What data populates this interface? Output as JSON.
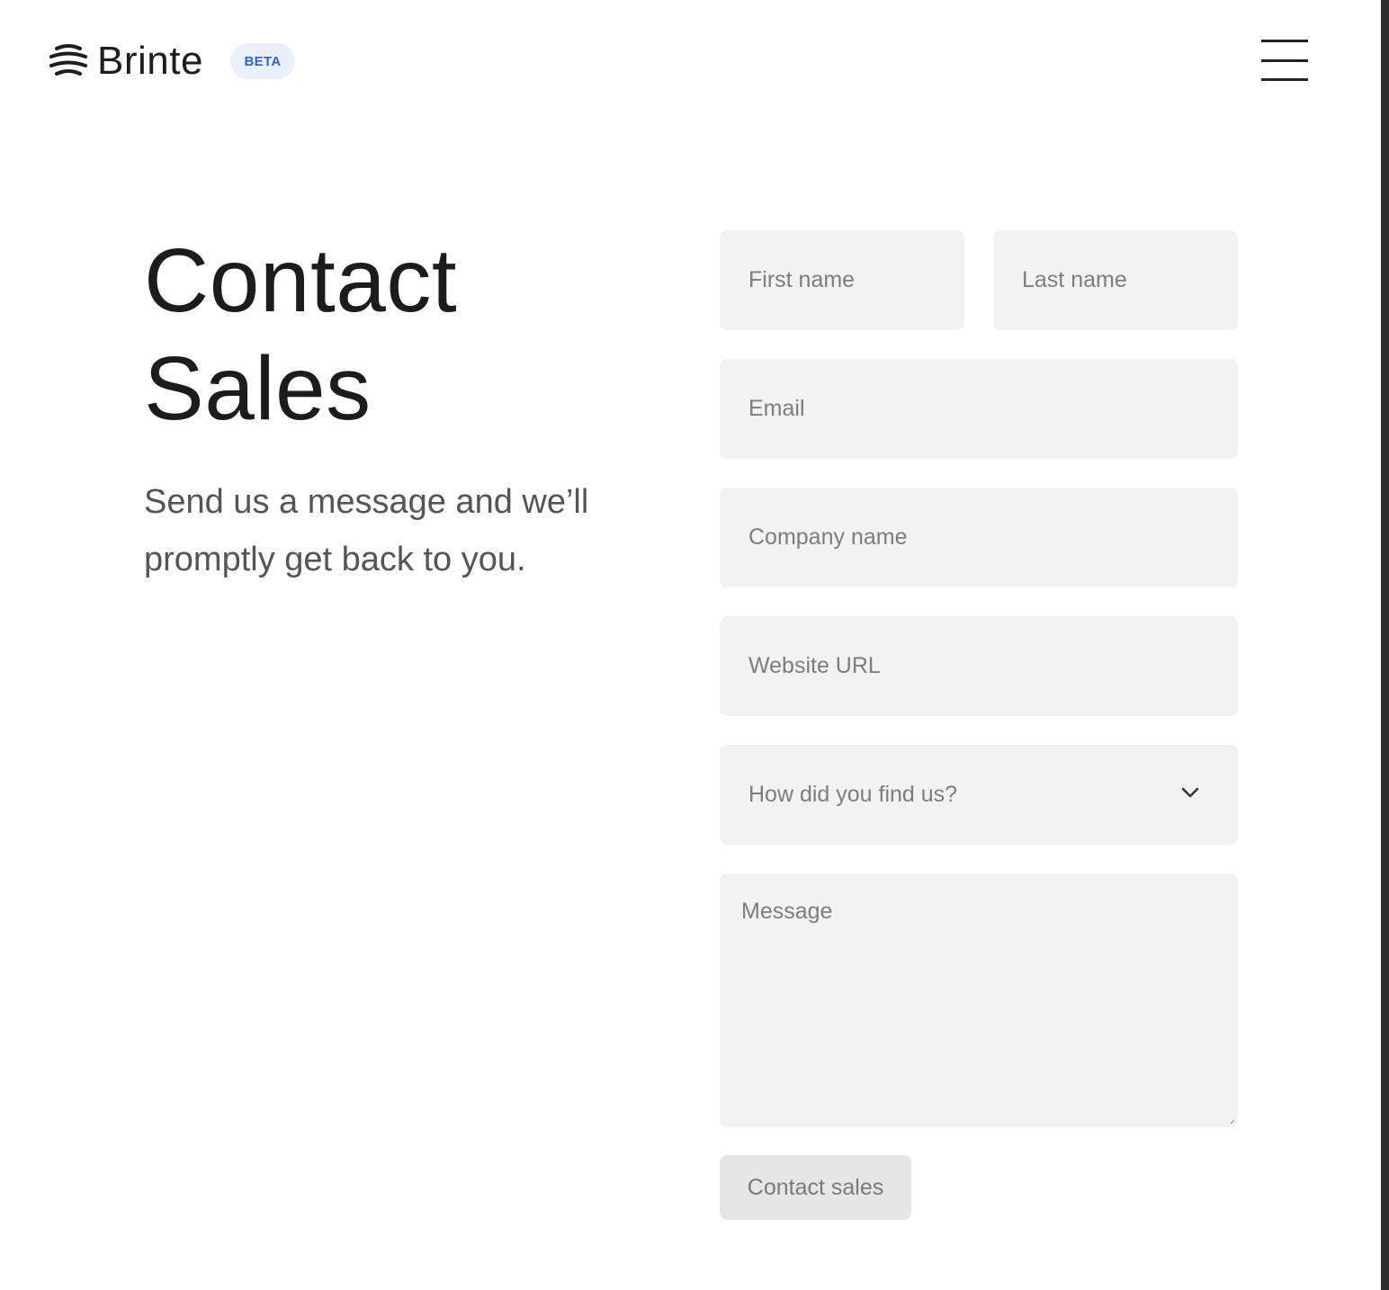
{
  "brand": {
    "name": "Brinte",
    "badge": "BETA",
    "logo_icon": "wave-lines-logo-icon",
    "badge_bg": "#e9f0fb",
    "badge_color": "#2f63c8"
  },
  "header": {
    "menu_icon": "hamburger-menu-icon"
  },
  "hero": {
    "title_line1": "Contact",
    "title_line2": "Sales",
    "subtitle": "Send us a message and we’ll promptly get back to you."
  },
  "form": {
    "first_name": {
      "placeholder": "First name",
      "value": ""
    },
    "last_name": {
      "placeholder": "Last name",
      "value": ""
    },
    "email": {
      "placeholder": "Email",
      "value": ""
    },
    "company": {
      "placeholder": "Company name",
      "value": ""
    },
    "website": {
      "placeholder": "Website URL",
      "value": ""
    },
    "source": {
      "placeholder": "How did you find us?",
      "icon": "chevron-down-icon"
    },
    "message": {
      "placeholder": "Message",
      "value": ""
    },
    "submit_label": "Contact sales",
    "field_bg": "#f2f2f2"
  }
}
